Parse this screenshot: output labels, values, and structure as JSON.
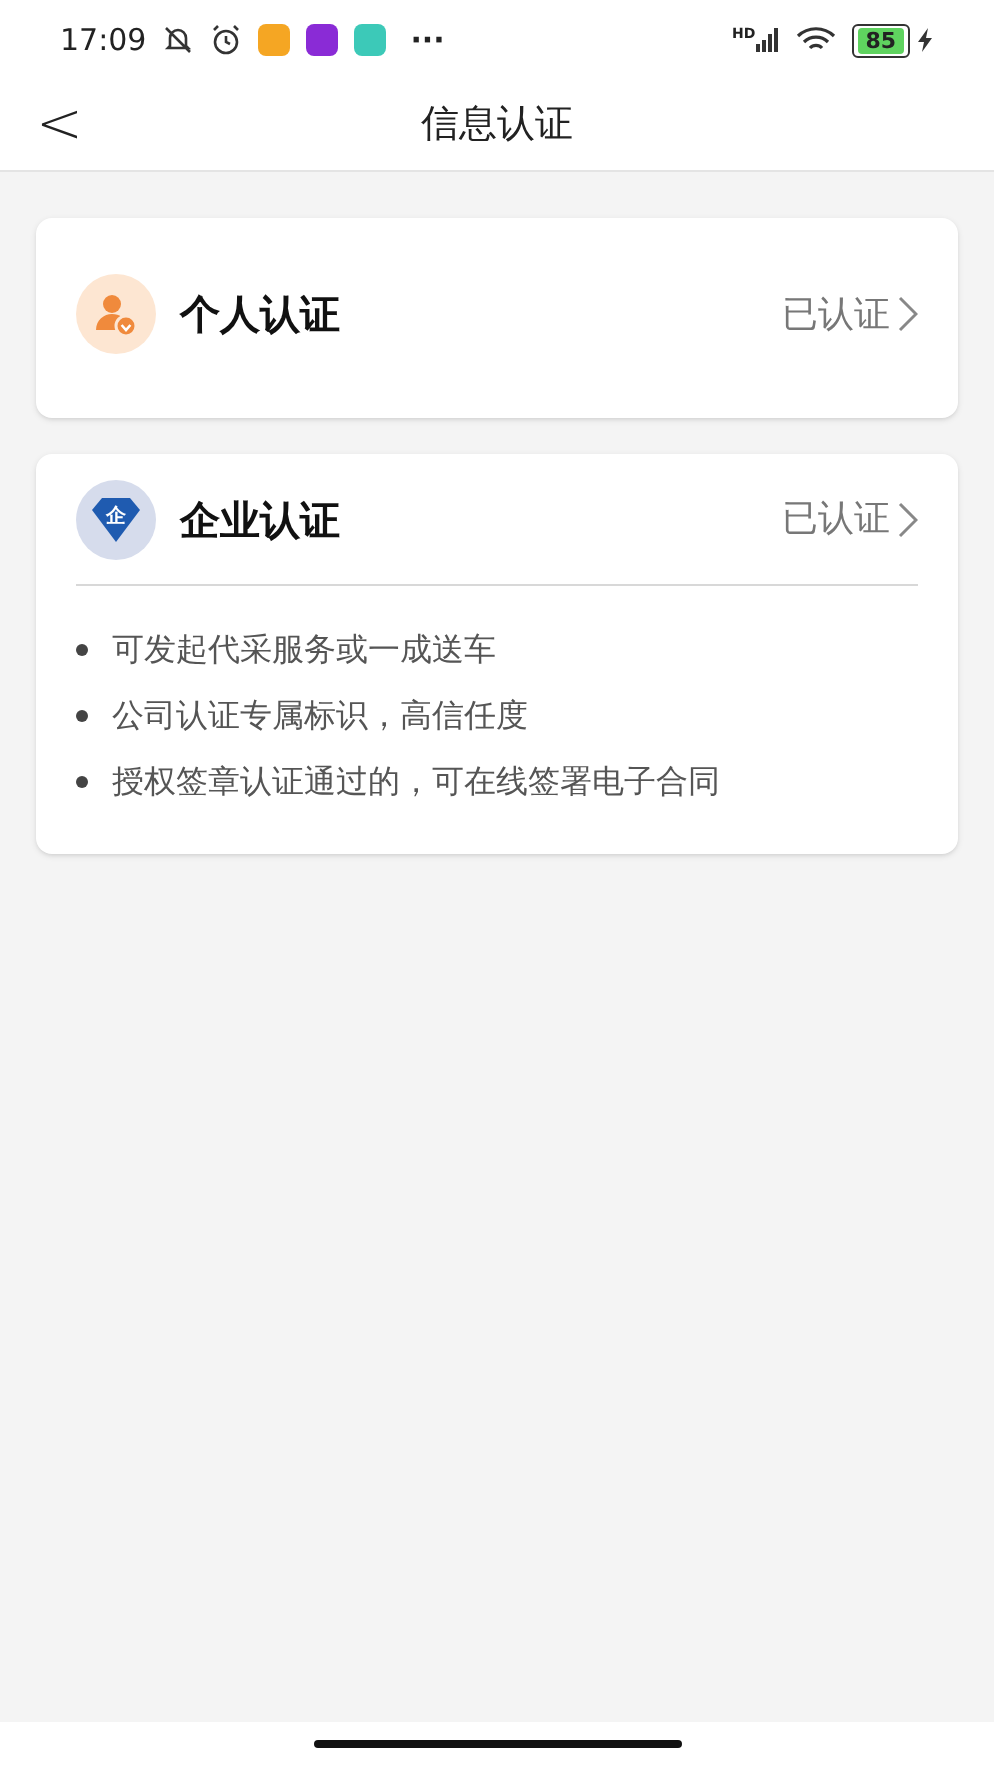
{
  "status_bar": {
    "time": "17:09",
    "more": "···",
    "network": "HD",
    "battery": "85"
  },
  "header": {
    "back": "<",
    "title": "信息认证"
  },
  "cards": [
    {
      "kind": "person",
      "title": "个人认证",
      "status": "已认证"
    },
    {
      "kind": "company",
      "icon_text": "企",
      "title": "企业认证",
      "status": "已认证",
      "bullets": [
        "可发起代采服务或一成送车",
        "公司认证专属标识，高信任度",
        "授权签章认证通过的，可在线签署电子合同"
      ]
    }
  ]
}
